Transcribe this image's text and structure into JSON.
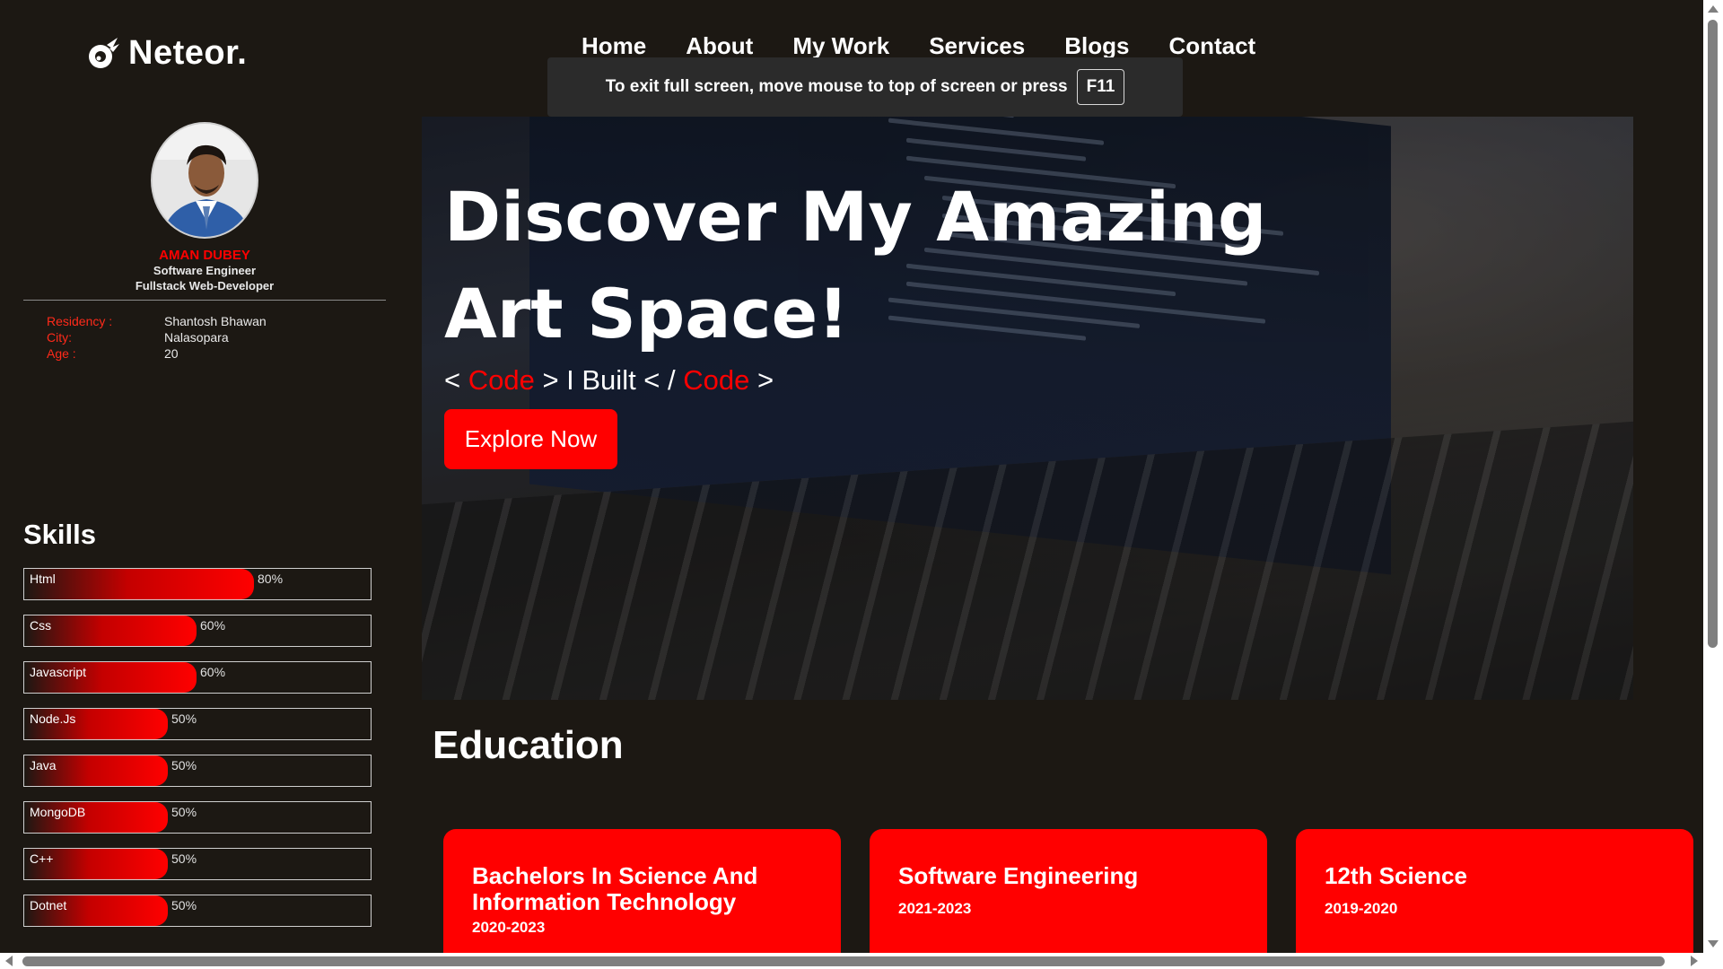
{
  "brand": {
    "name": "Neteor."
  },
  "nav": {
    "items": [
      "Home",
      "About",
      "My Work",
      "Services",
      "Blogs",
      "Contact"
    ]
  },
  "fullscreen_notice": {
    "text": "To exit full screen, move mouse to top of screen or press",
    "key": "F11"
  },
  "profile": {
    "name": "AMAN DUBEY",
    "role_1": "Software Engineer",
    "role_2": "Fullstack Web-Developer",
    "info": [
      {
        "label": "Residency :",
        "value": "Shantosh Bhawan"
      },
      {
        "label": "City:",
        "value": "Nalasopara"
      },
      {
        "label": "Age :",
        "value": "20"
      }
    ]
  },
  "skills": {
    "title": "Skills",
    "items": [
      {
        "name": "Html",
        "percent": 80,
        "label": "80%"
      },
      {
        "name": "Css",
        "percent": 60,
        "label": "60%"
      },
      {
        "name": "Javascript",
        "percent": 60,
        "label": "60%"
      },
      {
        "name": "Node.Js",
        "percent": 50,
        "label": "50%"
      },
      {
        "name": "Java",
        "percent": 50,
        "label": "50%"
      },
      {
        "name": "MongoDB",
        "percent": 50,
        "label": "50%"
      },
      {
        "name": "C++",
        "percent": 50,
        "label": "50%"
      },
      {
        "name": "Dotnet",
        "percent": 50,
        "label": "50%"
      }
    ]
  },
  "hero": {
    "title_line1": "Discover My Amazing",
    "title_line2": "Art Space!",
    "sub": {
      "p1": "< ",
      "code1": "Code",
      "p2": " > I Built < / ",
      "code2": "Code",
      "p3": " >"
    },
    "button": "Explore Now"
  },
  "education": {
    "title": "Education",
    "cards": [
      {
        "title": "Bachelors In Science And Information Technology",
        "years": "2020-2023"
      },
      {
        "title": "Software Engineering",
        "years": "2021-2023"
      },
      {
        "title": "12th Science",
        "years": "2019-2020"
      }
    ]
  },
  "colors": {
    "accent": "#ff0000",
    "background": "#1c1813"
  },
  "icons": {
    "logo": "meteor-icon"
  }
}
